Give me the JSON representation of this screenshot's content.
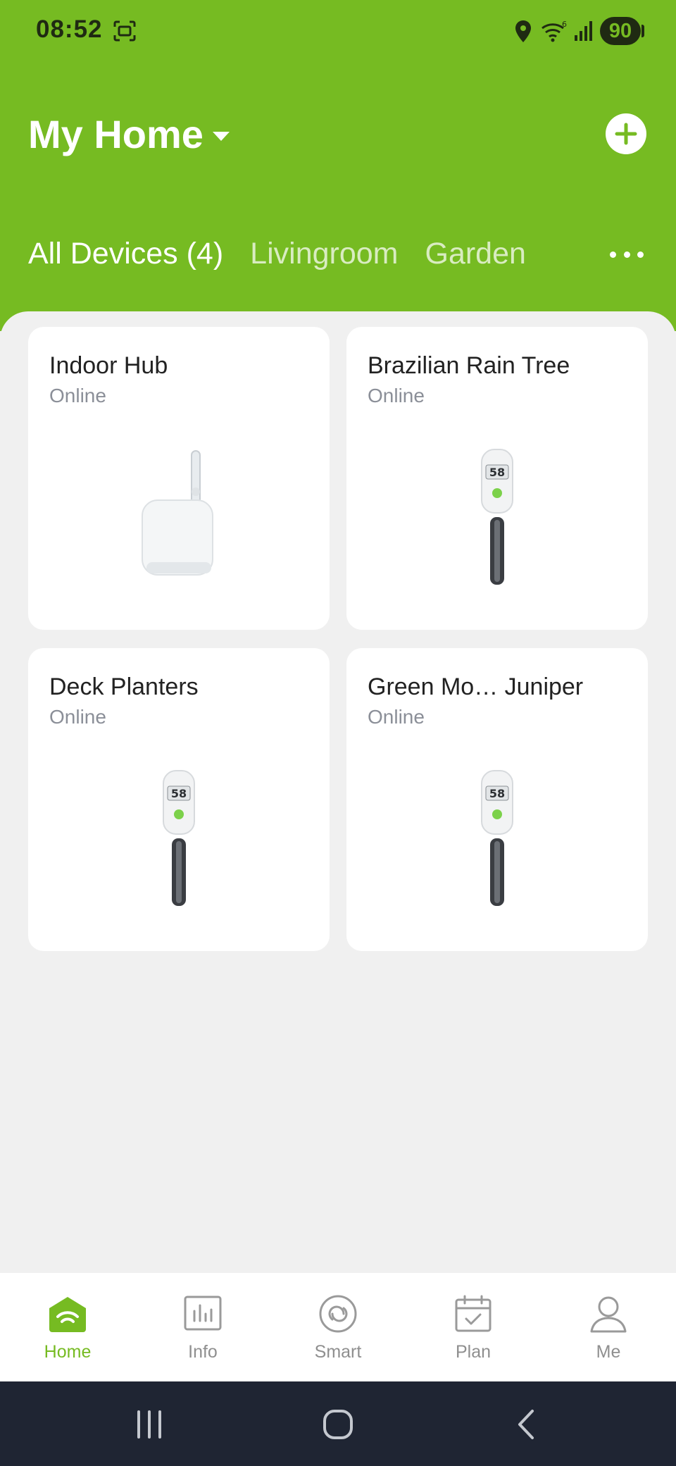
{
  "status_bar": {
    "time": "08:52",
    "battery": "90",
    "icons": [
      "screenshot-icon",
      "location-icon",
      "wifi-icon",
      "signal-icon"
    ]
  },
  "header": {
    "home_name": "My Home",
    "tabs": [
      {
        "label": "All Devices (4)",
        "active": true
      },
      {
        "label": "Livingroom",
        "active": false
      },
      {
        "label": "Garden",
        "active": false
      }
    ]
  },
  "devices": [
    {
      "name": "Indoor Hub",
      "status": "Online",
      "image": "hub"
    },
    {
      "name": "Brazilian Rain Tree",
      "status": "Online",
      "image": "soil-sensor",
      "display_reading": "58"
    },
    {
      "name": "Deck Planters",
      "status": "Online",
      "image": "soil-sensor",
      "display_reading": "58"
    },
    {
      "name": "Green Mo… Juniper",
      "status": "Online",
      "image": "soil-sensor",
      "display_reading": "58"
    }
  ],
  "bottom_nav": [
    {
      "label": "Home",
      "icon": "home-icon",
      "active": true
    },
    {
      "label": "Info",
      "icon": "chart-icon",
      "active": false
    },
    {
      "label": "Smart",
      "icon": "smart-icon",
      "active": false
    },
    {
      "label": "Plan",
      "icon": "calendar-icon",
      "active": false
    },
    {
      "label": "Me",
      "icon": "user-icon",
      "active": false
    }
  ],
  "colors": {
    "accent": "#76bb22",
    "background": "#f0f0f0",
    "card": "#ffffff",
    "status_text": "#8b8f98",
    "system_bar": "#1f2533"
  }
}
